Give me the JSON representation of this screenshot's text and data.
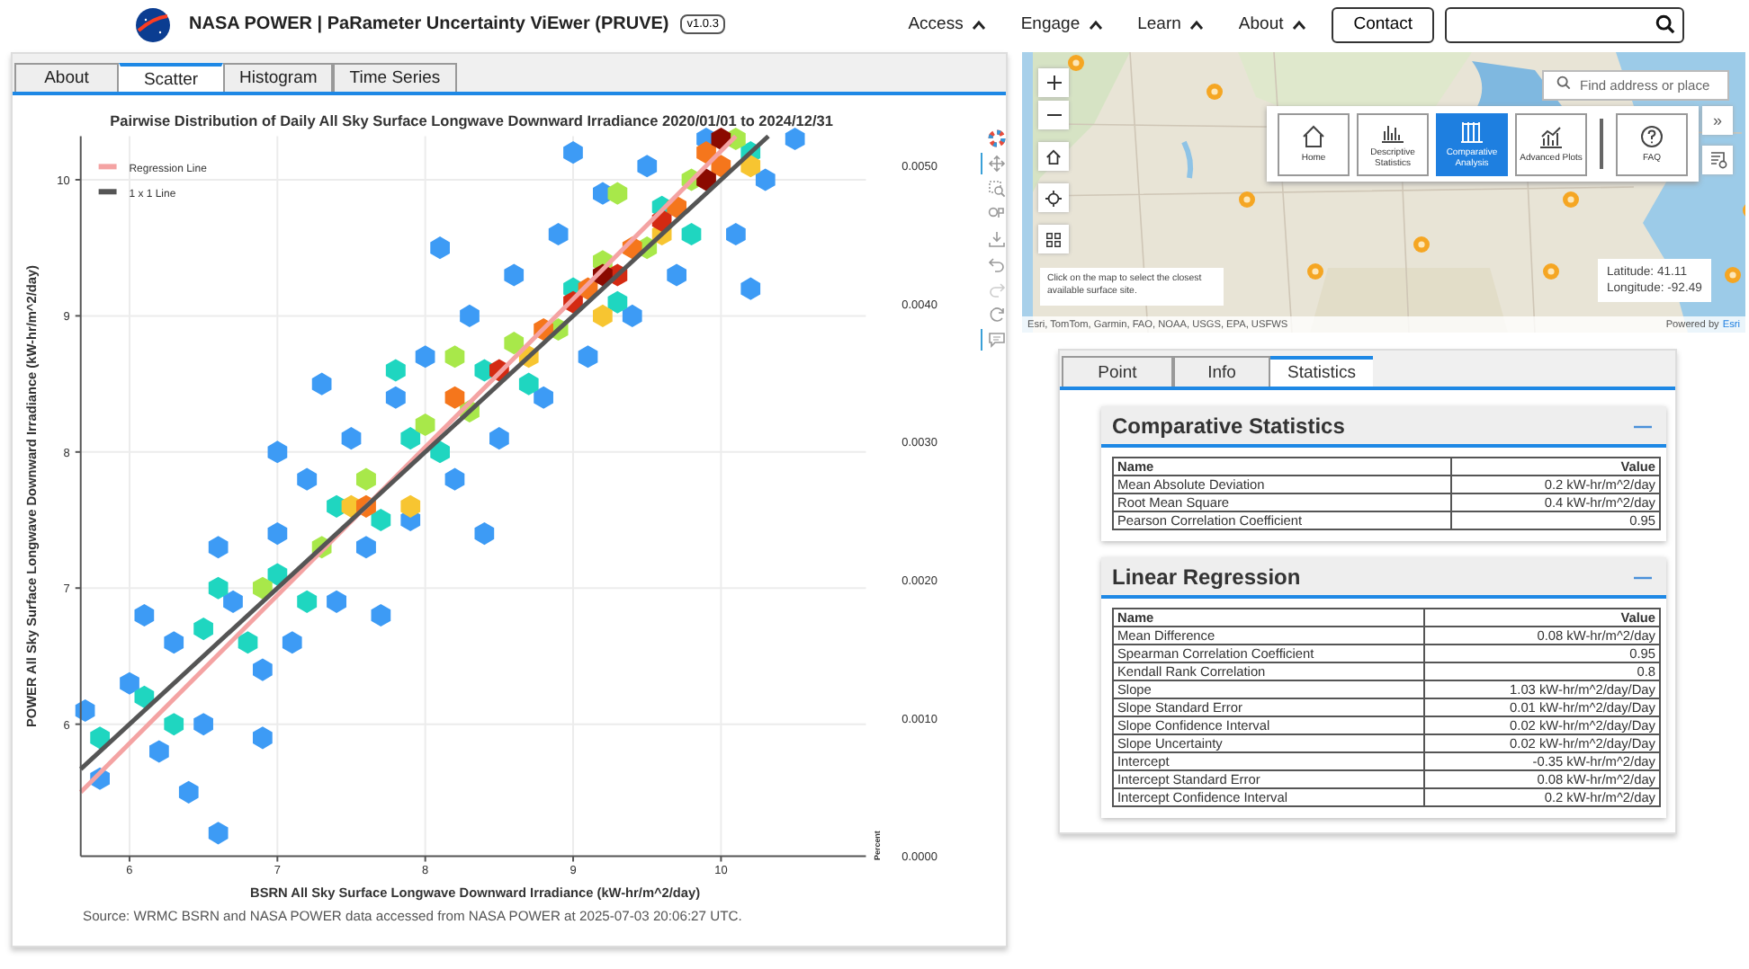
{
  "header": {
    "title": "NASA POWER | PaRameter Uncertainty ViEwer (PRUVE)",
    "version": "v1.0.3",
    "nav": [
      "Access",
      "Engage",
      "Learn",
      "About"
    ],
    "contact": "Contact"
  },
  "left_panel": {
    "tabs": [
      {
        "label": "About",
        "selected": false
      },
      {
        "label": "Scatter",
        "selected": true
      },
      {
        "label": "Histogram",
        "selected": false
      },
      {
        "label": "Time Series",
        "selected": false
      }
    ],
    "chart_data": {
      "type": "scatter",
      "title": "Pairwise Distribution of Daily All Sky Surface Longwave Downward Irradiance 2020/01/01 to 2024/12/31",
      "xlabel": "BSRN All Sky Surface Longwave Downward Irradiance (kW-hr/m^2/day)",
      "ylabel": "POWER All Sky Surface Longwave Downward Irradiance (kW-hr/m^2/day)",
      "y2label": "Percent",
      "grid": true,
      "legend": "top-left",
      "xlim": [
        5.67,
        10.98
      ],
      "ylim": [
        5.03,
        10.32
      ],
      "xticks": [
        6,
        7,
        8,
        9,
        10
      ],
      "yticks": [
        6,
        7,
        8,
        9,
        10
      ],
      "y2lim": [
        0,
        0.00521
      ],
      "y2ticks": [
        {
          "value": 0,
          "label": "0.0000"
        },
        {
          "value": 0.001,
          "label": "0.0010"
        },
        {
          "value": 0.002,
          "label": "0.0020"
        },
        {
          "value": 0.003,
          "label": "0.0030"
        },
        {
          "value": 0.004,
          "label": "0.0040"
        },
        {
          "value": 0.005,
          "label": "0.0050"
        }
      ],
      "series": [
        {
          "color": "#3d9bf5",
          "x": [
            5.8,
            6.0,
            6.2,
            6.3,
            6.5,
            6.6,
            6.7,
            6.9,
            7.0,
            7.1,
            7.2,
            7.4,
            7.5,
            7.6,
            7.8,
            7.9,
            8.0,
            8.2,
            8.3,
            8.5,
            8.6,
            8.8,
            8.9,
            9.1,
            9.2,
            9.4,
            9.5,
            9.7,
            9.9,
            10.1,
            10.3,
            5.7,
            6.1,
            7.3,
            8.1,
            6.6,
            9.0,
            10.5,
            6.4,
            7.7,
            6.9,
            8.4,
            10.2,
            7.0
          ],
          "values": [
            5.6,
            6.3,
            5.8,
            6.6,
            6.0,
            5.2,
            6.9,
            6.4,
            7.4,
            6.6,
            7.8,
            6.9,
            8.1,
            7.3,
            8.4,
            7.5,
            8.7,
            7.8,
            9.0,
            8.1,
            9.3,
            8.4,
            9.6,
            8.7,
            9.9,
            9.0,
            10.1,
            9.3,
            10.3,
            9.6,
            10.0,
            6.1,
            6.8,
            8.5,
            9.5,
            7.3,
            10.2,
            10.3,
            5.5,
            6.8,
            5.9,
            7.4,
            9.2,
            8.0
          ]
        },
        {
          "color": "#1fd6c0",
          "x": [
            5.8,
            6.1,
            6.3,
            6.5,
            6.8,
            7.0,
            7.2,
            7.4,
            7.7,
            7.9,
            8.1,
            8.4,
            8.7,
            9.0,
            9.3,
            9.6,
            9.8,
            10.2,
            6.6,
            7.8
          ],
          "values": [
            5.9,
            6.2,
            6.0,
            6.7,
            6.6,
            7.1,
            6.9,
            7.6,
            7.5,
            8.1,
            8.0,
            8.6,
            8.5,
            9.2,
            9.1,
            9.8,
            9.6,
            10.2,
            7.0,
            8.6
          ]
        },
        {
          "color": "#a8e84a",
          "x": [
            6.9,
            7.3,
            7.6,
            8.0,
            8.3,
            8.6,
            8.9,
            9.2,
            9.5,
            9.8,
            10.1,
            8.2,
            9.3
          ],
          "values": [
            7.0,
            7.3,
            7.8,
            8.2,
            8.3,
            8.8,
            8.9,
            9.4,
            9.5,
            10.0,
            10.3,
            8.7,
            9.9
          ]
        },
        {
          "color": "#f7c531",
          "x": [
            7.5,
            7.9,
            8.7,
            9.2,
            9.6,
            10.2
          ],
          "values": [
            7.6,
            7.6,
            8.7,
            9.0,
            9.6,
            10.1
          ]
        },
        {
          "color": "#f5761c",
          "x": [
            7.6,
            8.2,
            8.8,
            9.1,
            9.4,
            9.7,
            10.0,
            9.9
          ],
          "values": [
            7.6,
            8.4,
            8.9,
            9.2,
            9.5,
            9.8,
            10.1,
            10.2
          ]
        },
        {
          "color": "#d42a12",
          "x": [
            8.5,
            9.0,
            9.3,
            9.6
          ],
          "values": [
            8.6,
            9.1,
            9.3,
            9.7
          ]
        },
        {
          "color": "#8b0a00",
          "x": [
            9.9,
            10.0,
            9.2
          ],
          "values": [
            10.0,
            10.3,
            9.3
          ]
        },
        {
          "name": "Regression Line",
          "type": "line",
          "color": "#f4a3a3",
          "x": [
            5.67,
            10.1
          ],
          "values": [
            5.5,
            10.32
          ]
        },
        {
          "name": "1 x 1 Line",
          "type": "line",
          "color": "#555555",
          "x": [
            5.67,
            10.32
          ],
          "values": [
            5.67,
            10.32
          ]
        }
      ]
    },
    "toolbar": [
      {
        "kind": "logo",
        "selected": false
      },
      {
        "kind": "pan",
        "selected": true
      },
      {
        "kind": "zoom",
        "selected": false
      },
      {
        "kind": "lasso",
        "selected": false
      },
      {
        "kind": "download",
        "selected": false
      },
      {
        "kind": "undo",
        "selected": false
      },
      {
        "kind": "redo",
        "selected": false
      },
      {
        "kind": "reset",
        "selected": false
      },
      {
        "kind": "hover",
        "selected": true
      }
    ],
    "source": "Source: WRMC BSRN and NASA POWER data accessed from NASA POWER at 2025-07-03 20:06:27 UTC."
  },
  "map": {
    "search_placeholder": "Find address or place",
    "tools": [
      {
        "kind": "home",
        "label": "Home",
        "selected": false
      },
      {
        "kind": "bars",
        "label": "Descriptive Statistics",
        "selected": false
      },
      {
        "kind": "columns",
        "label": "Comparative Analysis",
        "selected": true
      },
      {
        "kind": "plots",
        "label": "Advanced Plots",
        "selected": false
      },
      {
        "kind": "faq",
        "label": "FAQ",
        "selected": false
      }
    ],
    "expand": "»",
    "hint": "Click on the map to select the closest available surface site.",
    "latitude": "Latitude: 41.11",
    "longitude": "Longitude: -92.49",
    "attribution": "Esri, TomTom, Garmin, FAO, NOAA, USGS, EPA, USFWS",
    "powered_by": "Powered by",
    "powered_link": "Esri"
  },
  "stats": {
    "tabs": [
      {
        "label": "Point",
        "selected": false
      },
      {
        "label": "Info",
        "selected": false
      },
      {
        "label": "Statistics",
        "selected": true
      }
    ],
    "sections": [
      {
        "title": "Comparative Statistics",
        "columns": [
          "Name",
          "Value"
        ],
        "rows": [
          [
            "Mean Absolute Deviation",
            "0.2 kW-hr/m^2/day"
          ],
          [
            "Root Mean Square",
            "0.4 kW-hr/m^2/day"
          ],
          [
            "Pearson Correlation Coefficient",
            "0.95"
          ]
        ]
      },
      {
        "title": "Linear Regression",
        "columns": [
          "Name",
          "Value"
        ],
        "rows": [
          [
            "Mean Difference",
            "0.08 kW-hr/m^2/day"
          ],
          [
            "Spearman Correlation Coefficient",
            "0.95"
          ],
          [
            "Kendall Rank Correlation",
            "0.8"
          ],
          [
            "Slope",
            "1.03 kW-hr/m^2/day/Day"
          ],
          [
            "Slope Standard Error",
            "0.01 kW-hr/m^2/day/Day"
          ],
          [
            "Slope Confidence Interval",
            "0.02 kW-hr/m^2/day/Day"
          ],
          [
            "Slope Uncertainty",
            "0.02 kW-hr/m^2/day/Day"
          ],
          [
            "Intercept",
            "-0.35 kW-hr/m^2/day"
          ],
          [
            "Intercept Standard Error",
            "0.08 kW-hr/m^2/day"
          ],
          [
            "Intercept Confidence Interval",
            "0.2 kW-hr/m^2/day"
          ]
        ]
      }
    ]
  }
}
